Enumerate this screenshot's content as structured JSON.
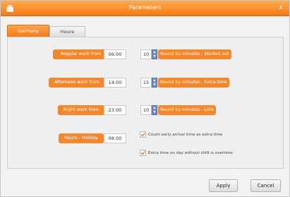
{
  "window": {
    "title": "Parameters"
  },
  "tabs": [
    {
      "label": "Germany"
    },
    {
      "label": "Heure"
    }
  ],
  "rows": [
    {
      "label": "Regular work from",
      "time": "06:00",
      "minutes": "10",
      "rule": "Round by minutes - Worked out"
    },
    {
      "label": "Afternoon work from",
      "time": "14:00",
      "minutes": "15",
      "rule": "Round by minutes - Extra time"
    },
    {
      "label": "Night work from",
      "time": "23:00",
      "minutes": "10",
      "rule": "Round by minutes - Late"
    },
    {
      "label": "Hours - Holiday",
      "time": "08:00"
    }
  ],
  "options": [
    {
      "label": "Count early arrival time as extra time",
      "checked": true
    },
    {
      "label": "Extra time on day without shift is overtime",
      "checked": true
    }
  ],
  "buttons": {
    "apply": "Apply",
    "cancel": "Cancel"
  },
  "colors": {
    "accent": "#f5872a",
    "spinner": "#6b8fd6"
  }
}
